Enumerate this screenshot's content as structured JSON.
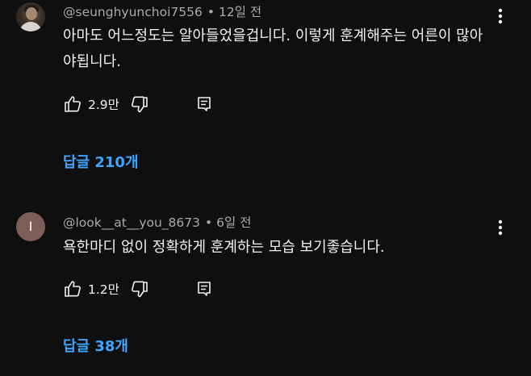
{
  "comments": [
    {
      "author": "@seunghyunchoi7556",
      "time": "12일 전",
      "text": "아마도 어느정도는 알아들었을겁니다. 이렇게 훈계해주는 어른이 많아야됩니다.",
      "likes": "2.9만",
      "replies": "답글 210개",
      "avatar": "photo"
    },
    {
      "author": "@look__at__you_8673",
      "time": "6일 전",
      "text": "욕한마디 없이 정확하게 훈계하는 모습 보기좋습니다.",
      "likes": "1.2만",
      "replies": "답글 38개",
      "avatar": "I"
    }
  ],
  "icons": {
    "like": "thumbs-up-icon",
    "dislike": "thumbs-down-icon",
    "reply": "reply-comment-icon",
    "more": "vertical-ellipsis-icon"
  },
  "colors": {
    "background": "#0f0f0f",
    "accent": "#3ea6ff",
    "secondary_text": "#aaaaaa",
    "primary_text": "#f1f1f1",
    "avatar_letter_bg": "#7c5e57"
  }
}
